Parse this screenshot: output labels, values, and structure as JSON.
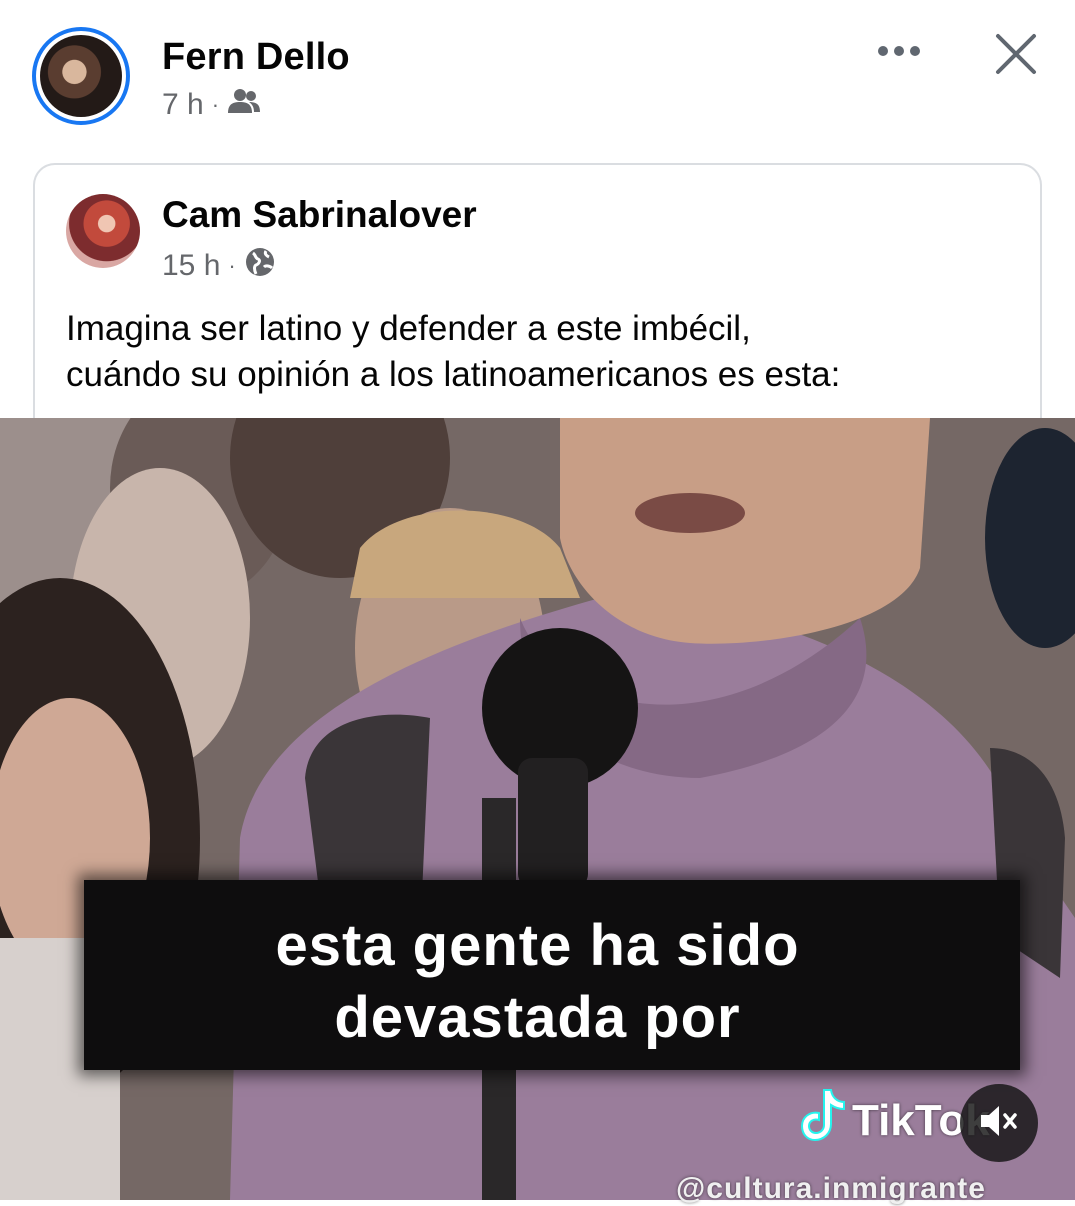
{
  "post": {
    "author": "Fern Dello",
    "time": "7 h",
    "separator": "·",
    "audience_icon": "friends-icon",
    "menu_icon": "more-icon",
    "close_icon": "close-icon"
  },
  "shared_post": {
    "author": "Cam Sabrinalover",
    "time": "15 h",
    "separator": "·",
    "audience_icon": "globe-icon",
    "text_line1": "Imagina ser latino y defender a este imbécil,",
    "text_line2": "cuándo su opinión a los latinoamericanos es esta:"
  },
  "video": {
    "caption_line1": "esta gente ha sido",
    "caption_line2": "devastada por",
    "watermark": "TikTok",
    "handle": "@cultura.inmigrante",
    "mute_icon": "speaker-muted-icon"
  },
  "colors": {
    "accent": "#1877f2",
    "meta_text": "#65676b",
    "card_border": "#dadde1"
  }
}
